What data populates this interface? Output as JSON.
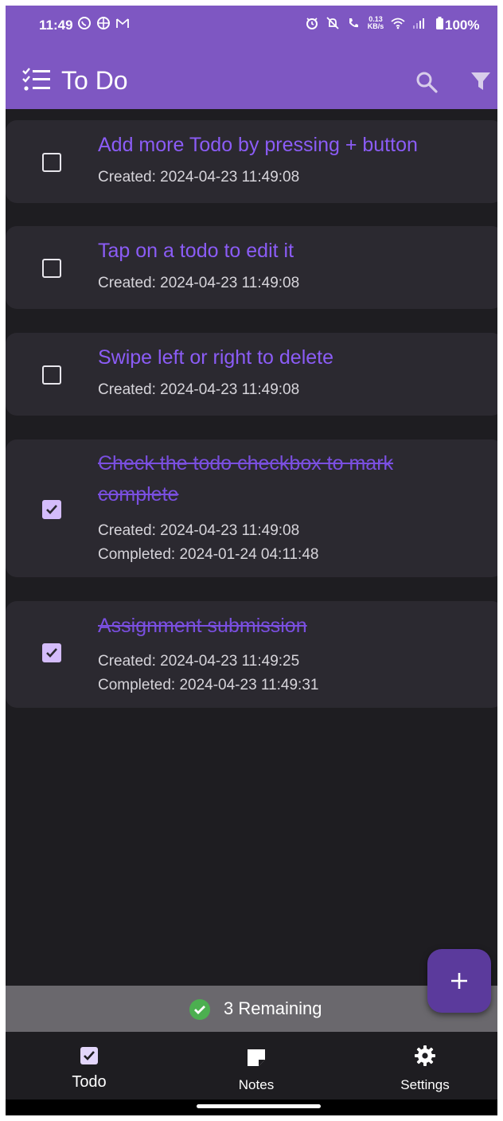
{
  "status_bar": {
    "time": "11:49",
    "network_speed_value": "0.13",
    "network_speed_unit": "KB/s",
    "battery": "100%"
  },
  "app_bar": {
    "title": "To Do",
    "icons": [
      "checklist-icon",
      "search-icon",
      "filter-icon"
    ]
  },
  "todos": [
    {
      "title": "Add more Todo by pressing + button",
      "created": "Created: 2024-04-23 11:49:08",
      "completed": null,
      "done": false
    },
    {
      "title": "Tap on a todo to edit it",
      "created": "Created: 2024-04-23 11:49:08",
      "completed": null,
      "done": false
    },
    {
      "title": "Swipe left or right to delete",
      "created": "Created: 2024-04-23 11:49:08",
      "completed": null,
      "done": false
    },
    {
      "title_line1": "Check the todo checkbox to mark",
      "title_line2": "complete",
      "created": "Created: 2024-04-23 11:49:08",
      "completed": "Completed: 2024-01-24 04:11:48",
      "done": true
    },
    {
      "title": "Assignment submission",
      "created": "Created: 2024-04-23 11:49:25",
      "completed": "Completed: 2024-04-23 11:49:31",
      "done": true
    }
  ],
  "fab": {
    "icon": "plus-icon"
  },
  "remaining": {
    "text": "3 Remaining"
  },
  "bottom_nav": [
    {
      "label": "Todo",
      "icon": "todo-check-icon",
      "active": true
    },
    {
      "label": "Notes",
      "icon": "note-icon",
      "active": false
    },
    {
      "label": "Settings",
      "icon": "gear-icon",
      "active": false
    }
  ],
  "colors": {
    "primary": "#7e57c2",
    "accent_text": "#8b5cf6",
    "background": "#1e1d21",
    "card": "#2b2930",
    "checkbox_checked": "#d4bcfb",
    "remaining_bar": "#6a686d",
    "success": "#4caf50"
  }
}
